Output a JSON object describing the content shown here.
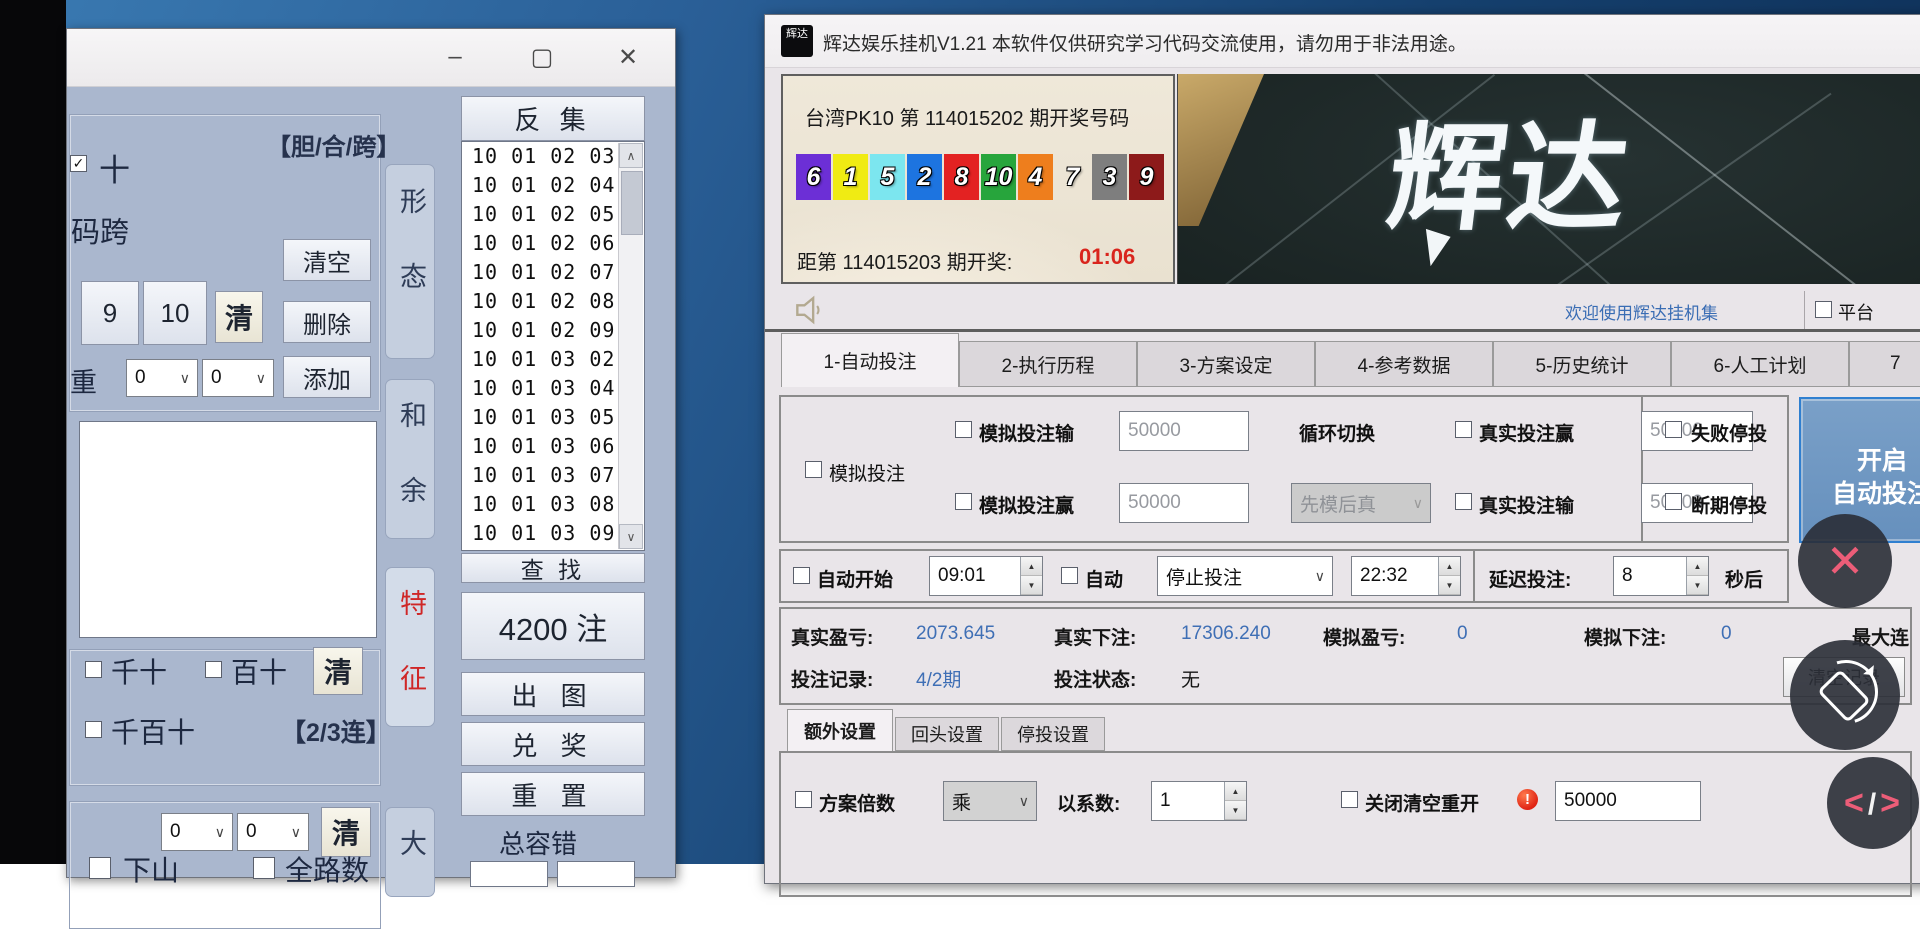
{
  "icons": {
    "minimize": "–",
    "maximize": "▢",
    "close": "✕",
    "check": "✓",
    "up": "▲",
    "down": "▼",
    "dropdown": "∨",
    "scroll_up": "∧",
    "scroll_down": "∨",
    "warning": "!"
  },
  "colors": {
    "value_blue": "#3f6fb5",
    "countdown_red": "#d9251d",
    "link_blue": "#3a6db4",
    "tezheng_red": "#cf2727"
  },
  "left_window": {
    "bet_group": {
      "title": "【胆/合/跨】",
      "cb_ten": "十",
      "span_label": "码跨",
      "btn_9": "9",
      "btn_10": "10",
      "btn_clear_short": "清",
      "btn_clear": "清空",
      "btn_delete": "删除",
      "btn_add": "添加",
      "weight_label": "重",
      "weight_dd1": "0",
      "weight_dd2": "0"
    },
    "pos_group": {
      "cb_qianshi": "千十",
      "cb_baishi": "百十",
      "btn_clear": "清",
      "cb_qianbaishi": "千百十",
      "tag": "【2/3连】"
    },
    "route_group": {
      "dd1": "0",
      "dd2": "0",
      "btn_clear": "清",
      "cb_xiashan": "下山",
      "cb_quanlushu": "全路数"
    },
    "side_tabs": {
      "xingtai": "形态",
      "heyu": "和余",
      "tezheng": "特征",
      "da": "大"
    },
    "fanji": {
      "header": "反 集",
      "items": [
        "10 01 02 03",
        "10 01 02 04",
        "10 01 02 05",
        "10 01 02 06",
        "10 01 02 07",
        "10 01 02 08",
        "10 01 02 09",
        "10 01 03 02",
        "10 01 03 04",
        "10 01 03 05",
        "10 01 03 06",
        "10 01 03 07",
        "10 01 03 08",
        "10 01 03 09"
      ],
      "find_btn": "查 找",
      "count_btn": "4200 注",
      "chart_btn": "出 图",
      "redeem_btn": "兑 奖",
      "reset_btn": "重 置",
      "tolerance_label": "总容错"
    }
  },
  "main_window": {
    "title": "辉达娱乐挂机V1.21 本软件仅供研究学习代码交流使用，请勿用于非法用途。",
    "app_icon_label": "辉达",
    "lottery": {
      "heading": "台湾PK10 第 114015202 期开奖号码",
      "balls": [
        {
          "n": "6",
          "color": "#6c2fd6"
        },
        {
          "n": "1",
          "color": "#f0eb13"
        },
        {
          "n": "5",
          "color": "#7ce6ef"
        },
        {
          "n": "2",
          "color": "#1d74e0"
        },
        {
          "n": "8",
          "color": "#e32222"
        },
        {
          "n": "10",
          "color": "#27a53c"
        },
        {
          "n": "4",
          "color": "#ee7e1d"
        },
        {
          "n": "7",
          "color": "none"
        },
        {
          "n": "3",
          "color": "#7e7e7e"
        },
        {
          "n": "9",
          "color": "#8d1a1a"
        }
      ],
      "countdown_label": "距第 114015203 期开奖:",
      "countdown": "01:06"
    },
    "banner_logo": "辉达",
    "status_row": {
      "welcome": "欢迎使用辉达挂机集",
      "platform": "平台"
    },
    "tabs": [
      "1-自动投注",
      "2-执行历程",
      "3-方案设定",
      "4-参考数据",
      "5-历史统计",
      "6-人工计划",
      "7"
    ],
    "sim_group": {
      "cb_sim": "模拟投注",
      "cb_sim_lose": "模拟投注输",
      "sim_lose_val": "50000",
      "loop_label": "循环切换",
      "cb_real_win": "真实投注赢",
      "real_win_val": "50000",
      "cb_fail_stop": "失败停投",
      "cb_sim_win": "模拟投注赢",
      "sim_win_val": "50000",
      "mode_dd": "先模后真",
      "cb_real_lose": "真实投注输",
      "real_lose_val": "50000",
      "cb_break_stop": "断期停投",
      "start_btn_line1": "开启",
      "start_btn_line2": "自动投注"
    },
    "auto_row": {
      "cb_auto_start": "自动开始",
      "start_time": "09:01",
      "cb_auto": "自动",
      "action_dd": "停止投注",
      "stop_time": "22:32",
      "delay_label": "延迟投注:",
      "delay_val": "8",
      "delay_suffix": "秒后"
    },
    "stats": {
      "real_pl_label": "真实盈亏:",
      "real_pl": "2073.645",
      "real_bet_label": "真实下注:",
      "real_bet": "17306.240",
      "sim_pl_label": "模拟盈亏:",
      "sim_pl": "0",
      "sim_bet_label": "模拟下注:",
      "sim_bet": "0",
      "max_label": "最大连",
      "rec_label": "投注记录:",
      "rec": "4/2期",
      "state_label": "投注状态:",
      "state": "无",
      "clear_btn": "清空记录"
    },
    "extra": {
      "tab_extra": "额外设置",
      "tab_back": "回头设置",
      "tab_stop": "停投设置",
      "cb_multiplier": "方案倍数",
      "mult_dd": "乘",
      "factor_label": "以系数:",
      "factor": "1",
      "cb_restart": "关闭清空重开",
      "restart_val": "50000"
    }
  },
  "overlay": {
    "close": "✕",
    "code_left": "&lt;",
    "code_slash": "/",
    "code_right": "&gt;"
  }
}
